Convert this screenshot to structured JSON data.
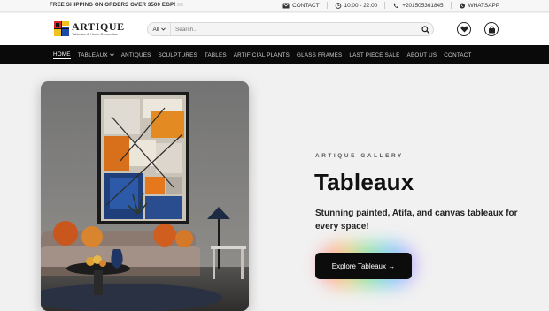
{
  "topbar": {
    "promo": "FREE SHIPPING ON ORDERS OVER 3500 EGP!",
    "contact": "CONTACT",
    "hours": "10:00 - 22:00",
    "phone": "+201505361845",
    "whatsapp": "WHATSAPP"
  },
  "header": {
    "logo_name": "ARTIQUE",
    "logo_sub": "Tableaux & Home Decoration",
    "search_category": "All",
    "search_placeholder": "Search..."
  },
  "nav": {
    "items": [
      {
        "label": "HOME"
      },
      {
        "label": "TABLEAUX"
      },
      {
        "label": "ANTIQUES"
      },
      {
        "label": "SCULPTURES"
      },
      {
        "label": "TABLES"
      },
      {
        "label": "ARTIFICIAL PLANTS"
      },
      {
        "label": "GLASS FRAMES"
      },
      {
        "label": "LAST PIECE SALE"
      },
      {
        "label": "ABOUT US"
      },
      {
        "label": "CONTACT"
      }
    ]
  },
  "hero": {
    "eyebrow": "ARTIQUE GALLERY",
    "title": "Tableaux",
    "description": "Stunning painted, Atifa, and canvas tableaux for every space!",
    "cta": "Explore Tableaux →"
  },
  "colors": {
    "nav_bg": "#0a0a0a",
    "hero_bg": "#f1f1f1",
    "cta_bg": "#0c0c0c",
    "accent_orange": "#e07a1f",
    "accent_blue": "#1f3f7a"
  }
}
